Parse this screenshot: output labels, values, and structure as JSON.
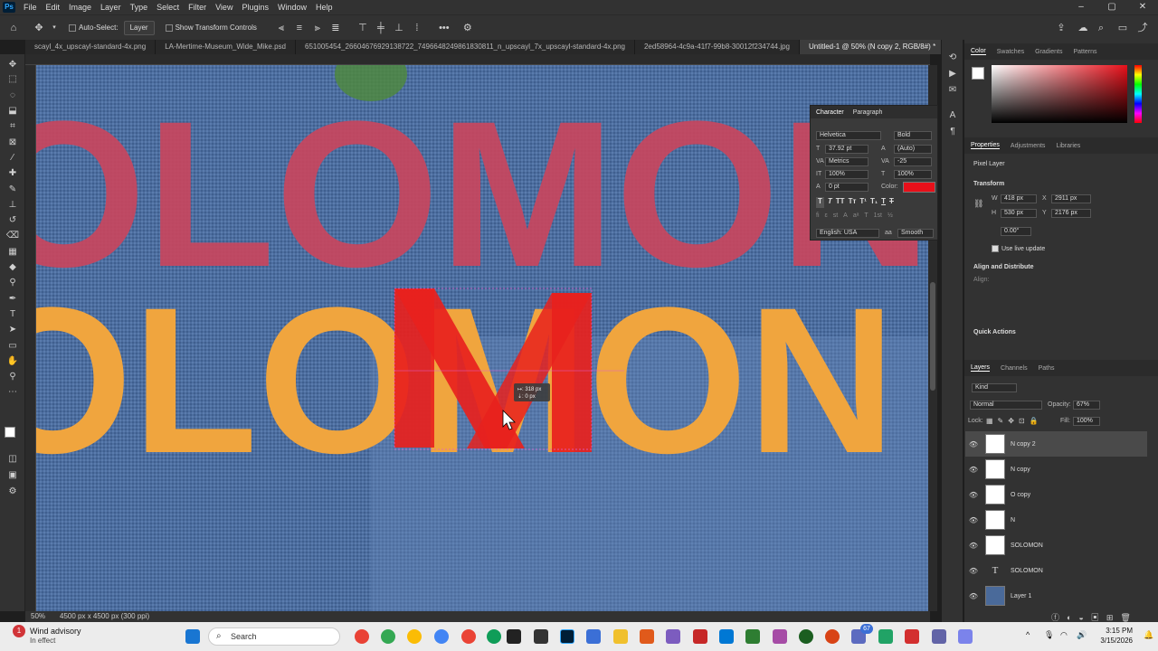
{
  "menu": {
    "app_icon": "Ps",
    "items": [
      "File",
      "Edit",
      "Image",
      "Layer",
      "Type",
      "Select",
      "Filter",
      "View",
      "Plugins",
      "Window",
      "Help"
    ]
  },
  "options": {
    "auto_select": "Auto-Select:",
    "auto_select_target": "Layer",
    "transform_controls": "Show Transform Controls"
  },
  "tabs": [
    {
      "label": "scayl_4x_upscayl-standard-4x.png",
      "active": false
    },
    {
      "label": "LA-Mertime-Museum_Wide_Mike.psd",
      "active": false
    },
    {
      "label": "651005454_26604676929138722_7496648249861830811_n_upscayl_7x_upscayl-standard-4x.png",
      "active": false
    },
    {
      "label": "2ed58964-4c9a-41f7-99b8-30012f234744.jpg",
      "active": false
    },
    {
      "label": "Untitled-1 @ 50% (N copy 2, RGB/8#) *",
      "active": true
    }
  ],
  "canvas": {
    "top_text": "OLOMON",
    "bottom_text": "OLOMON",
    "tooltip_w": "↦: 318 px",
    "tooltip_h": "⇣: 0 px",
    "colors": {
      "top_letters": "#c8465e",
      "bottom_letters": "#f0a53e",
      "highlight": "#e8211d",
      "fabric": "#4a6a9a"
    }
  },
  "status": {
    "zoom": "50%",
    "doc": "4500 px x 4500 px (300 ppi)"
  },
  "character": {
    "tab_character": "Character",
    "tab_paragraph": "Paragraph",
    "font": "Helvetica",
    "style": "Bold",
    "size": "37.92 pt",
    "leading": "(Auto)",
    "kerning": "Metrics",
    "tracking": "-25",
    "vscale": "100%",
    "hscale": "100%",
    "baseline": "0 pt",
    "color_label": "Color:",
    "color": "#e8101a",
    "language": "English: USA",
    "aa_label": "aa",
    "antialias": "Smooth"
  },
  "color_panel": {
    "tabs": [
      "Color",
      "Swatches",
      "Gradients",
      "Patterns"
    ]
  },
  "properties": {
    "tabs": [
      "Properties",
      "Adjustments",
      "Libraries"
    ],
    "kind": "Pixel Layer",
    "transform": "Transform",
    "w_label": "W",
    "w": "418 px",
    "x_label": "X",
    "x": "2911 px",
    "h_label": "H",
    "h": "530 px",
    "y_label": "Y",
    "y": "2176 px",
    "angle": "0.00°",
    "live_update": "Use live update",
    "align": "Align and Distribute",
    "align_label": "Align:",
    "quick": "Quick Actions"
  },
  "layers_panel": {
    "tabs": [
      "Layers",
      "Channels",
      "Paths"
    ],
    "kind": "Kind",
    "blend": "Normal",
    "opacity_label": "Opacity:",
    "opacity": "67%",
    "lock_label": "Lock:",
    "fill_label": "Fill:",
    "fill": "100%",
    "layers": [
      {
        "name": "N copy 2",
        "type": "pixel",
        "selected": true
      },
      {
        "name": "N copy",
        "type": "pixel",
        "selected": false
      },
      {
        "name": "O copy",
        "type": "pixel",
        "selected": false
      },
      {
        "name": "N",
        "type": "pixel",
        "selected": false
      },
      {
        "name": "SOLOMON",
        "type": "pixel",
        "selected": false
      },
      {
        "name": "SOLOMON",
        "type": "text",
        "selected": false
      },
      {
        "name": "Layer 1",
        "type": "image",
        "selected": false
      }
    ]
  },
  "taskbar": {
    "weather_title": "Wind advisory",
    "weather_sub": "In effect",
    "badge": "1",
    "search": "Search",
    "time": "3:15 PM",
    "date": "3/15/2026",
    "notif": "67"
  }
}
